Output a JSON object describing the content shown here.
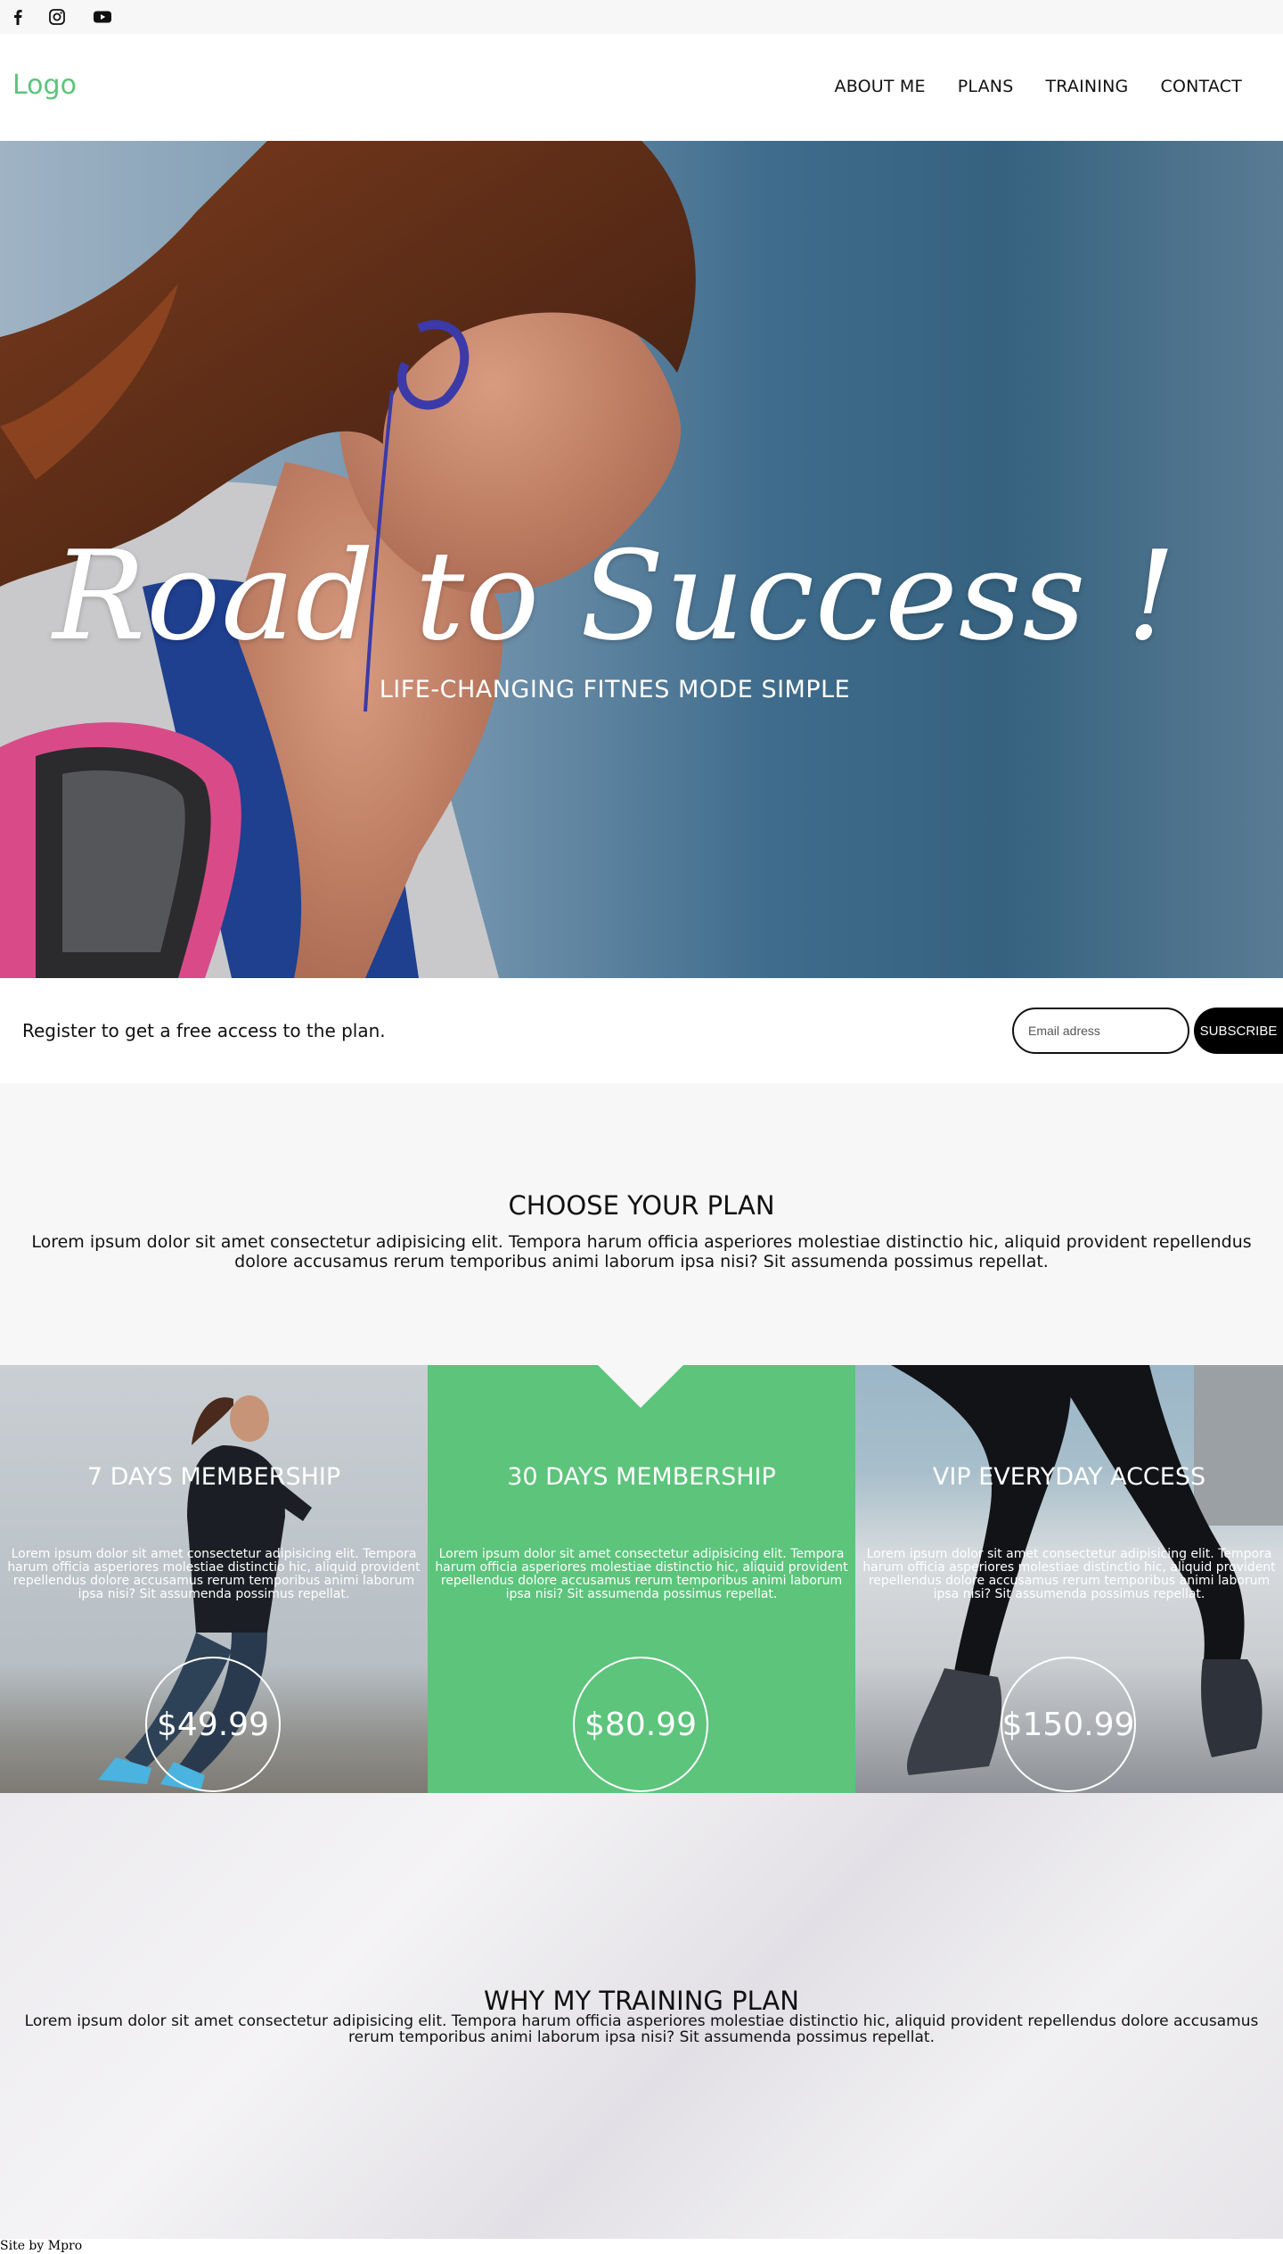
{
  "social": {
    "icons": [
      "facebook-icon",
      "instagram-icon",
      "youtube-icon"
    ]
  },
  "header": {
    "logo": "Logo",
    "nav": [
      "ABOUT ME",
      "PLANS",
      "TRAINING",
      "CONTACT"
    ]
  },
  "hero": {
    "title": "Road to Success !",
    "subtitle": "LIFE-CHANGING FITNES MODE SIMPLE"
  },
  "register": {
    "text": "Register to get a free access to the plan.",
    "email_placeholder": "Email adress",
    "subscribe_label": "SUBSCRIBE"
  },
  "choose": {
    "title": "CHOOSE YOUR PLAN",
    "text": "Lorem ipsum dolor sit amet consectetur adipisicing elit. Tempora harum officia asperiores molestiae distinctio hic, aliquid provident repellendus dolore accusamus rerum temporibus animi laborum ipsa nisi? Sit assumenda possimus repellat."
  },
  "plans": [
    {
      "title": "7 DAYS MEMBERSHIP",
      "text": "Lorem ipsum dolor sit amet consectetur adipisicing elit. Tempora harum officia asperiores molestiae distinctio hic, aliquid provident repellendus dolore accusamus rerum temporibus animi laborum ipsa nisi? Sit assumenda possimus repellat.",
      "price": "$49.99"
    },
    {
      "title": "30 DAYS MEMBERSHIP",
      "text": "Lorem ipsum dolor sit amet consectetur adipisicing elit. Tempora harum officia asperiores molestiae distinctio hic, aliquid provident repellendus dolore accusamus rerum temporibus animi laborum ipsa nisi? Sit assumenda possimus repellat.",
      "price": "$80.99"
    },
    {
      "title": "VIP EVERYDAY ACCESS",
      "text": "Lorem ipsum dolor sit amet consectetur adipisicing elit. Tempora harum officia asperiores molestiae distinctio hic, aliquid provident repellendus dolore accusamus rerum temporibus animi laborum ipsa nisi? Sit assumenda possimus repellat.",
      "price": "$150.99"
    }
  ],
  "why": {
    "title": "WHY MY TRAINING PLAN",
    "text": "Lorem ipsum dolor sit amet consectetur adipisicing elit. Tempora harum officia asperiores molestiae distinctio hic, aliquid provident repellendus dolore accusamus rerum temporibus animi laborum ipsa nisi? Sit assumenda possimus repellat."
  },
  "footer": {
    "text": "Site by Mpro"
  },
  "colors": {
    "accent": "#5cc47b",
    "dark": "#000000",
    "light_bg": "#f7f7f7"
  }
}
